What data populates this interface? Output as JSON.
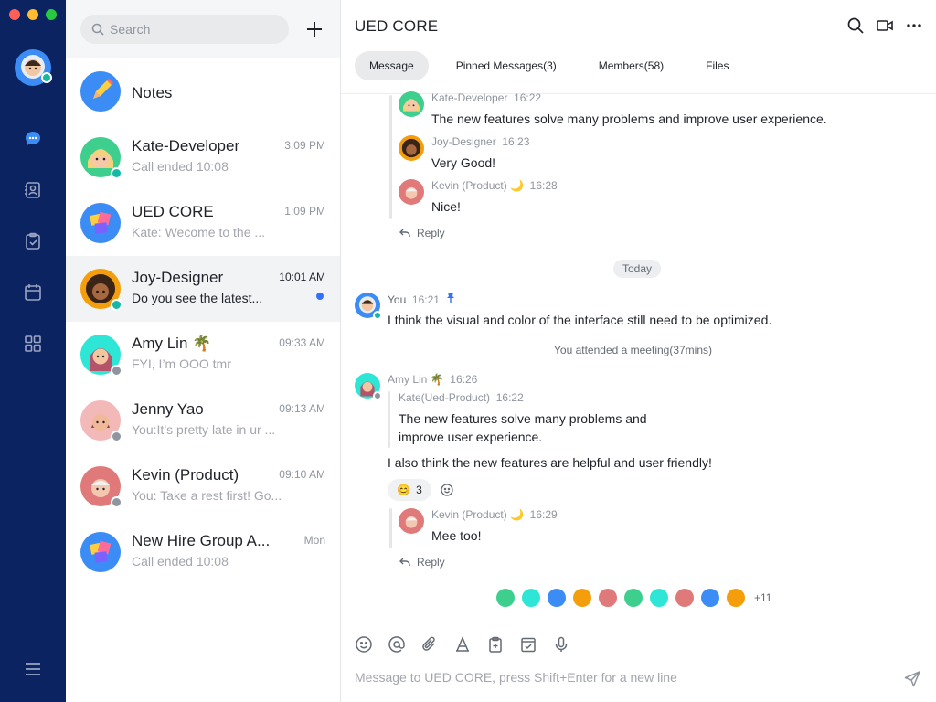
{
  "window": {
    "dot_colors": [
      "#ff5f57",
      "#febc2e",
      "#28c840"
    ]
  },
  "rail": {
    "items": [
      {
        "icon": "chat-bubble-icon",
        "active": true
      },
      {
        "icon": "contacts-icon",
        "active": false
      },
      {
        "icon": "tasks-icon",
        "active": false
      },
      {
        "icon": "calendar-icon",
        "active": false
      },
      {
        "icon": "apps-grid-icon",
        "active": false
      }
    ],
    "menu_icon": "hamburger-menu-icon"
  },
  "sidebar": {
    "search_placeholder": "Search",
    "chats": [
      {
        "name": "Notes",
        "time": "",
        "preview": "",
        "avatar": "notes-pencil"
      },
      {
        "name": "Kate-Developer",
        "time": "3:09 PM",
        "preview": "Call ended 10:08",
        "avatar": "kate",
        "status": "online"
      },
      {
        "name": "UED CORE",
        "time": "1:09 PM",
        "preview": "Kate: Wecome to the ...",
        "avatar": "group"
      },
      {
        "name": "Joy-Designer",
        "time": "10:01 AM",
        "preview": "Do you see the latest...",
        "avatar": "joy",
        "status": "online",
        "unread": true
      },
      {
        "name": "Amy Lin 🌴",
        "time": "09:33 AM",
        "preview": "FYI, I’m OOO tmr",
        "avatar": "amy",
        "status": "away"
      },
      {
        "name": "Jenny Yao",
        "time": "09:13 AM",
        "preview": "You:It’s pretty late in ur ...",
        "avatar": "jenny",
        "status": "away"
      },
      {
        "name": "Kevin (Product)",
        "time": "09:10 AM",
        "preview": "You: Take a rest first! Go...",
        "avatar": "kevin",
        "status": "away"
      },
      {
        "name": "New Hire Group A...",
        "time": "Mon",
        "preview": "Call ended 10:08",
        "avatar": "group"
      }
    ]
  },
  "chat": {
    "title": "UED CORE",
    "tabs": [
      "Message",
      "Pinned Messages(3)",
      "Members(58)",
      "Files"
    ],
    "thread1": [
      {
        "author": "Kate-Developer",
        "time": "16:22",
        "text": "The new features solve many problems and improve user experience."
      },
      {
        "author": "Joy-Designer",
        "time": "16:23",
        "text": "Very Good!"
      },
      {
        "author": "Kevin (Product) 🌙",
        "time": "16:28",
        "text": "Nice!"
      }
    ],
    "reply_label": "Reply",
    "date_divider": "Today",
    "my_message": {
      "author": "You",
      "time": "16:21",
      "text": "I think the visual and color of the interface still need to be optimized."
    },
    "system_note": "You attended a meeting(37mins)",
    "amy_message": {
      "author": "Amy Lin 🌴",
      "time": "16:26",
      "quote_author": "Kate(Ued-Product)",
      "quote_time": "16:22",
      "quote_line1": "The new features solve many problems and",
      "quote_line2": "improve user experience.",
      "text": "I also think the new features are helpful and user friendly!",
      "reaction_emoji": "😊",
      "reaction_count": "3"
    },
    "thread2": [
      {
        "author": "Kevin (Product) 🌙",
        "time": "16:29",
        "text": "Mee too!"
      }
    ],
    "read_more": "+11",
    "composer_placeholder": "Message to UED CORE, press Shift+Enter for a new line"
  },
  "colors": {
    "rail": "#0c2361",
    "accent": "#3370ff",
    "online": "#14b8a6",
    "away": "#8f959e"
  }
}
